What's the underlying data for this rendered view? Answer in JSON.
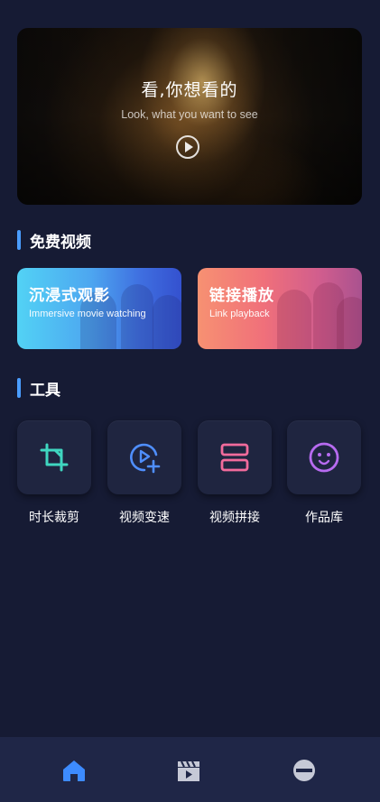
{
  "banner": {
    "title": "看,你想看的",
    "subtitle": "Look, what you want to see",
    "play_icon": "play-circle-icon"
  },
  "free_video": {
    "heading": "免费视频",
    "cards": [
      {
        "title": "沉浸式观影",
        "subtitle": "Immersive movie watching"
      },
      {
        "title": "链接播放",
        "subtitle": "Link playback"
      }
    ]
  },
  "tools": {
    "heading": "工具",
    "items": [
      {
        "label": "时长裁剪",
        "icon": "crop-icon"
      },
      {
        "label": "视频变速",
        "icon": "video-speed-icon"
      },
      {
        "label": "视频拼接",
        "icon": "video-merge-icon"
      },
      {
        "label": "作品库",
        "icon": "smiley-icon"
      }
    ]
  },
  "nav": {
    "items": [
      {
        "icon": "home-icon",
        "active": true
      },
      {
        "icon": "video-clapper-icon",
        "active": false
      },
      {
        "icon": "profile-icon",
        "active": false
      }
    ]
  },
  "colors": {
    "background": "#161b34",
    "accent": "#4a9dff",
    "crop_icon": "#3fd6c0",
    "speed_icon": "#4f8fff",
    "merge_icon": "#f26b9c",
    "smiley_icon": "#b76bf0",
    "nav_active": "#3d8bff",
    "nav_inactive": "#c6c9d6"
  }
}
